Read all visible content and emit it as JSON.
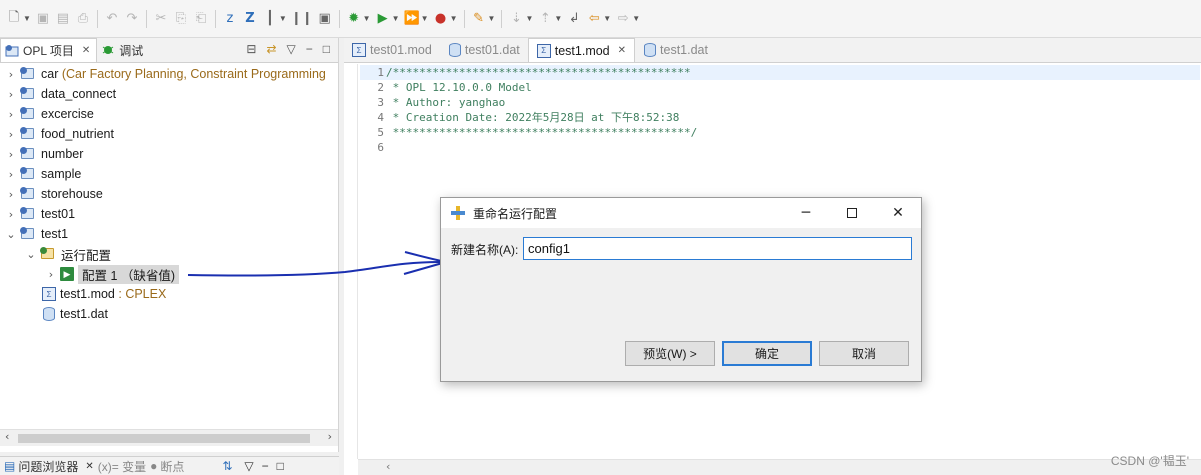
{
  "toolbar": {
    "buttons": [
      {
        "name": "new-icon"
      },
      {
        "name": "save-icon"
      },
      {
        "name": "save-all-icon"
      },
      {
        "name": "print-icon"
      },
      {
        "name": "undo-icon"
      },
      {
        "name": "redo-icon"
      },
      {
        "name": "cut-icon"
      },
      {
        "name": "copy-icon"
      },
      {
        "name": "paste-icon"
      },
      {
        "name": "z-icon",
        "label": "z"
      },
      {
        "name": "z-bold-icon",
        "label": "Z"
      },
      {
        "name": "debug-icon"
      },
      {
        "name": "run-icon"
      },
      {
        "name": "run-config-icon"
      },
      {
        "name": "stop-icon"
      },
      {
        "name": "tools-icon"
      },
      {
        "name": "nav-back-icon"
      },
      {
        "name": "nav-forward-icon"
      }
    ]
  },
  "left_panel": {
    "tabs": [
      {
        "label": "OPL 项目",
        "active": true
      },
      {
        "label": "调试",
        "active": false
      }
    ],
    "tree": [
      {
        "label": "car",
        "desc": "(Car Factory Planning, Constraint Programming",
        "expanded": false
      },
      {
        "label": "data_connect",
        "expanded": false
      },
      {
        "label": "excercise",
        "expanded": false
      },
      {
        "label": "food_nutrient",
        "expanded": false
      },
      {
        "label": "number",
        "expanded": false
      },
      {
        "label": "sample",
        "expanded": false
      },
      {
        "label": "storehouse",
        "expanded": false
      },
      {
        "label": "test01",
        "expanded": false
      },
      {
        "label": "test1",
        "expanded": true
      }
    ],
    "run_configs": {
      "label": "运行配置"
    },
    "config_item": {
      "label": "配置 1 （缺省值)"
    },
    "mod_file": {
      "label": "test1.mod",
      "desc": ": CPLEX"
    },
    "dat_file": {
      "label": "test1.dat"
    }
  },
  "bottom_tabs": {
    "problems": "问题浏览器",
    "variables": "(x)= 变量",
    "breakpoints": "断点"
  },
  "editor": {
    "tabs": [
      {
        "label": "test01.mod",
        "active": false
      },
      {
        "label": "test01.dat",
        "active": false
      },
      {
        "label": "test1.mod",
        "active": true
      },
      {
        "label": "test1.dat",
        "active": false
      }
    ],
    "lines": [
      {
        "num": "1",
        "text": "/*********************************************"
      },
      {
        "num": "2",
        "text": " * OPL 12.10.0.0 Model"
      },
      {
        "num": "3",
        "text": " * Author: yanghao"
      },
      {
        "num": "4",
        "text": " * Creation Date: 2022年5月28日 at 下午8:52:38"
      },
      {
        "num": "5",
        "text": " *********************************************/"
      },
      {
        "num": "6",
        "text": ""
      }
    ]
  },
  "dialog": {
    "title": "重命名运行配置",
    "field_label": "新建名称(A):",
    "field_value": "config1",
    "preview_button": "预览(W) >",
    "ok_button": "确定",
    "cancel_button": "取消"
  },
  "watermark": "CSDN @'韫玉'",
  "colors": {
    "accent": "#2a7bd4",
    "comment": "#3f7f5f",
    "annotation_arrow": "#1a2fb0"
  }
}
